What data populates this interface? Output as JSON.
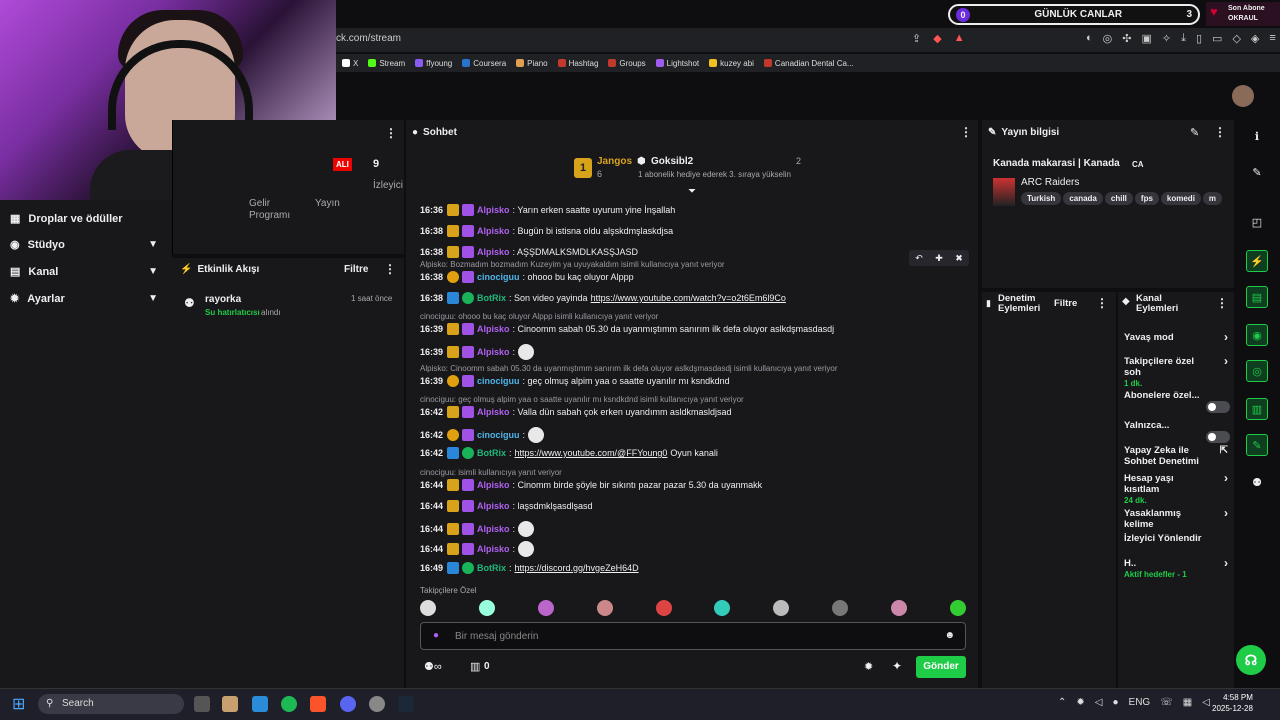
{
  "browser": {
    "url": "ck.com/stream"
  },
  "bookmarks": [
    {
      "label": "X",
      "color": "#ffffff"
    },
    {
      "label": "Stream",
      "color": "#53fc18"
    },
    {
      "label": "ffyoung",
      "color": "#8a5cf6"
    },
    {
      "label": "Coursera",
      "color": "#2a73cc"
    },
    {
      "label": "Piano",
      "color": "#e0a050"
    },
    {
      "label": "Hashtag",
      "color": "#c0392b"
    },
    {
      "label": "Groups",
      "color": "#c0392b"
    },
    {
      "label": "Lightshot",
      "color": "#a05cf0"
    },
    {
      "label": "kuzey abi",
      "color": "#f0c020"
    },
    {
      "label": "Canadian Dental Ca...",
      "color": "#c0392b"
    }
  ],
  "goal": {
    "left": "0",
    "label": "GÜNLÜK CANLAR",
    "right": "3"
  },
  "subscriber": {
    "line1": "Son Abone",
    "line2": "OKRAUL"
  },
  "leftnav": {
    "drops": "Droplar ve ödüller",
    "studio": "Stüdyo",
    "channel": "Kanal",
    "settings": "Ayarlar"
  },
  "topleft": {
    "badge": "ALI",
    "viewers_count": "9",
    "viewers_label": "İzleyici",
    "col1": "Gelir",
    "col1b": "Programı",
    "col2": "Yayın"
  },
  "activity": {
    "title": "Etkinlik Akışı",
    "filter": "Filtre",
    "user": "rayorka",
    "action": "Su hatırlatıcısı",
    "action_suffix": "alındı",
    "time": "1 saat önce"
  },
  "chat": {
    "title": "Sohbet",
    "leader1": {
      "name": "Jangos",
      "count": "6",
      "rank": "1"
    },
    "leader2": {
      "name": "Goksibl2",
      "count": "2",
      "note": "1 abonelik hediye ederek 3. sıraya yükselin"
    },
    "messages": [
      {
        "time": "16:36",
        "user": "Alpisko",
        "text": ": Yarın erken saatte uyurum yine İnşallah"
      },
      {
        "time": "16:38",
        "user": "Alpisko",
        "text": ": Bugün bi istisna oldu alşskdmşlaskdjsa"
      },
      {
        "time": "16:38",
        "user": "Alpisko",
        "text": ": AŞŞDMALKSMDLKASŞJASD"
      },
      {
        "reply": "Alpisko: Bozmadım bozmadım Kuzeyim ya uyuyakaldım isimli kullanıcıya yanıt veriyor"
      },
      {
        "time": "16:38",
        "user": "cinociguu",
        "text": ": ohooo bu kaç oluyor Alppp"
      },
      {
        "time": "16:38",
        "user": "BotRix",
        "text": ": Son video yayinda ",
        "link": "https://www.youtube.com/watch?v=o2t6Em6l9Co"
      },
      {
        "reply": "cinociguu: ohooo bu kaç oluyor Alppp isimli kullanıcıya yanıt veriyor"
      },
      {
        "time": "16:39",
        "user": "Alpisko",
        "text": ": Cinoomm sabah 05.30 da uyanmıştımm sanırım ilk defa oluyor aslkdşmasdasdj"
      },
      {
        "time": "16:39",
        "user": "Alpisko",
        "text": ":"
      },
      {
        "reply": "Alpisko: Cinoomm sabah 05.30 da uyanmıştımm sanırım ilk defa oluyor aslkdşmasdasdj isimli kullanıcıya yanıt veriyor"
      },
      {
        "time": "16:39",
        "user": "cinociguu",
        "text": ": geç olmuş alpim yaa o saatte uyanılır mı ksndkdnd"
      },
      {
        "reply": "cinociguu: geç olmuş alpim yaa o saatte uyanılır mı ksndkdnd isimli kullanıcıya yanıt veriyor"
      },
      {
        "time": "16:42",
        "user": "Alpisko",
        "text": ": Valla dün sabah çok erken uyandımm asldkmasldjsad"
      },
      {
        "time": "16:42",
        "user": "cinociguu",
        "text": ":"
      },
      {
        "time": "16:42",
        "user": "BotRix",
        "text": ": ",
        "link": "https://www.youtube.com/@FFYoung0",
        "after": " Oyun kanali"
      },
      {
        "reply": "cinociguu: isimli kullanıcıya yanıt veriyor"
      },
      {
        "time": "16:44",
        "user": "Alpisko",
        "text": ": Cinomm birde şöyle bir sıkıntı pazar pazar 5.30 da uyanmakk"
      },
      {
        "time": "16:44",
        "user": "Alpisko",
        "text": ": laşsdmklşasdlşasd"
      },
      {
        "time": "16:44",
        "user": "Alpisko",
        "text": ":"
      },
      {
        "time": "16:44",
        "user": "Alpisko",
        "text": ":"
      },
      {
        "time": "16:49",
        "user": "BotRix",
        "text": ": ",
        "link": "https://discord.gg/hvgeZeH64D"
      }
    ],
    "followers_only": "Takipçilere Özel",
    "placeholder": "Bir mesaj gönderin",
    "points": "0",
    "send": "Gönder"
  },
  "stream_info": {
    "title": "Yayın bilgisi",
    "stream_title": "Kanada makarasi | Kanada",
    "flag": "CA",
    "game": "ARC Raiders",
    "tags": [
      "Turkish",
      "canada",
      "chill",
      "fps",
      "komedi",
      "m"
    ]
  },
  "mod": {
    "title": "Denetim Eylemleri",
    "filter": "Filtre"
  },
  "channel_actions": {
    "title": "Kanal Eylemleri",
    "items": [
      {
        "label": "Yavaş mod",
        "sub": ""
      },
      {
        "label": "Takipçilere özel soh",
        "sub": "1 dk."
      },
      {
        "label": "Abonelere özel...",
        "sub": ""
      },
      {
        "label": "Yalnızca...",
        "sub": ""
      },
      {
        "label": "Yapay Zeka ile Sohbet Denetimi",
        "sub": ""
      },
      {
        "label": "Hesap yaşı kısıtlam",
        "sub": "24 dk."
      },
      {
        "label": "Yasaklanmış kelime",
        "sub": ""
      },
      {
        "label": "İzleyici Yönlendir",
        "sub": ""
      },
      {
        "label": "H..",
        "sub": "Aktif hedefler - 1"
      }
    ]
  },
  "taskbar": {
    "search": "Search",
    "lang": "ENG",
    "time": "4:58 PM",
    "date": "2025-12-28"
  }
}
